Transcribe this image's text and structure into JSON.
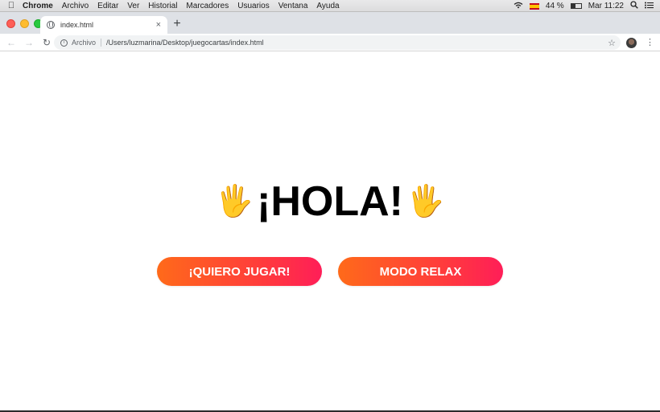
{
  "menubar": {
    "app_name": "Chrome",
    "items": [
      "Archivo",
      "Editar",
      "Ver",
      "Historial",
      "Marcadores",
      "Usuarios",
      "Ventana",
      "Ayuda"
    ],
    "battery": "44 %",
    "clock": "Mar 11:22"
  },
  "tab": {
    "title": "index.html",
    "close": "×",
    "new_tab": "+"
  },
  "toolbar": {
    "back": "←",
    "forward": "→",
    "reload": "↻",
    "scheme_label": "Archivo",
    "url": "/Users/luzmarina/Desktop/juegocartas/index.html",
    "star": "☆",
    "menu": "⋮"
  },
  "page": {
    "wave_left": "🖐",
    "title": "¡HOLA!",
    "wave_right": "🖐",
    "play_button": "¡QUIERO JUGAR!",
    "relax_button": "MODO RELAX"
  },
  "colors": {
    "button_gradient_start": "#ff6a1a",
    "button_gradient_end": "#ff1e58"
  }
}
